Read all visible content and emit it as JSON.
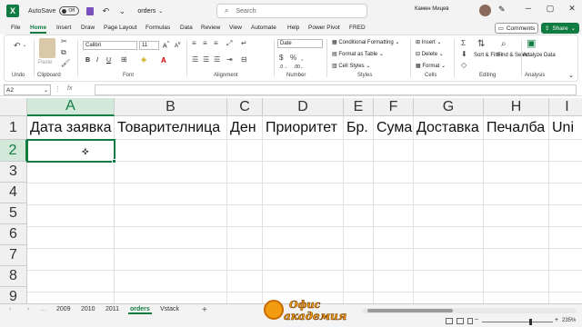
{
  "titlebar": {
    "app_logo": "X",
    "autosave_label": "AutoSave",
    "autosave_state": "Off",
    "filename": "orders",
    "search_placeholder": "Search",
    "user_name": "Камен Мицев"
  },
  "menu": {
    "tabs": [
      "File",
      "Home",
      "Insert",
      "Draw",
      "Page Layout",
      "Formulas",
      "Data",
      "Review",
      "View",
      "Automate",
      "Help",
      "Power Pivot",
      "FRED"
    ],
    "active": "Home",
    "comments_label": "Comments",
    "share_label": "Share"
  },
  "ribbon": {
    "undo_label": "Undo",
    "clipboard_label": "Clipboard",
    "paste_label": "Paste",
    "font_label": "Font",
    "font_name": "Calibri",
    "font_size": "11",
    "alignment_label": "Alignment",
    "number_label": "Number",
    "number_format": "Date",
    "styles_label": "Styles",
    "conditional_formatting": "Conditional Formatting",
    "format_as_table": "Format as Table",
    "cell_styles": "Cell Styles",
    "cells_label": "Cells",
    "insert": "Insert",
    "delete": "Delete",
    "format": "Format",
    "editing_label": "Editing",
    "sort_filter": "Sort & Filter",
    "find_select": "Find & Select",
    "analysis_label": "Analysis",
    "analyze_data": "Analyze Data",
    "bold": "B",
    "italic": "I",
    "underline": "U"
  },
  "formula_bar": {
    "name_box": "A2",
    "fx": "fx",
    "value": ""
  },
  "grid": {
    "columns": [
      "A",
      "B",
      "C",
      "D",
      "E",
      "F",
      "G",
      "H",
      "I"
    ],
    "rows": [
      "1",
      "2",
      "3",
      "4",
      "5",
      "6",
      "7",
      "8",
      "9"
    ],
    "row1": [
      "Дата заявка",
      "Товарителница",
      "Ден",
      "Приоритет",
      "Бр.",
      "Сума",
      "Доставка",
      "Печалба",
      "Uni"
    ],
    "active_cell": "A2"
  },
  "sheets": {
    "tabs": [
      "2009",
      "2010",
      "2011",
      "orders",
      "Vstack"
    ],
    "active": "orders"
  },
  "status": {
    "zoom": "235%"
  },
  "watermark": {
    "line1": "Офис",
    "line2": "академия"
  }
}
